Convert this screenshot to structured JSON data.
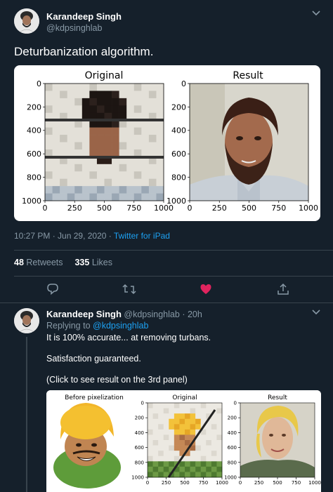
{
  "tweet": {
    "author_name": "Karandeep Singh",
    "author_handle": "@kdpsinghlab",
    "text": "Deturbanization algorithm.",
    "image": {
      "left_title": "Original",
      "right_title": "Result",
      "y_ticks": [
        "0",
        "200",
        "400",
        "600",
        "800",
        "1000"
      ],
      "x_ticks": [
        "0",
        "250",
        "500",
        "750",
        "1000"
      ]
    },
    "time": "10:27 PM",
    "date": "Jun 29, 2020",
    "separator": "·",
    "source": "Twitter for iPad",
    "retweets_count": "48",
    "retweets_label": "Retweets",
    "likes_count": "335",
    "likes_label": "Likes"
  },
  "actions": {
    "reply_icon": "reply-icon",
    "retweet_icon": "retweet-icon",
    "like_icon": "heart-icon",
    "share_icon": "share-icon",
    "like_color": "#e0245e"
  },
  "reply": {
    "author_name": "Karandeep Singh",
    "author_handle": "@kdpsinghlab",
    "dot": "·",
    "age": "20h",
    "replying_prefix": "Replying to",
    "replying_to": "@kdpsinghlab",
    "line1": "It is 100% accurate... at removing turbans.",
    "line2": "Satisfaction guaranteed.",
    "line3": "(Click to see result on the 3rd panel)",
    "image": {
      "panel1_title": "Before pixelization",
      "panel2_title": "Original",
      "panel3_title": "Result",
      "y_ticks": [
        "0",
        "200",
        "400",
        "600",
        "800",
        "1000"
      ],
      "x_ticks": [
        "0",
        "250",
        "500",
        "750",
        "1000"
      ]
    }
  },
  "colors": {
    "background": "#15202b",
    "secondary_text": "#8899a6",
    "link": "#1da1f2"
  }
}
